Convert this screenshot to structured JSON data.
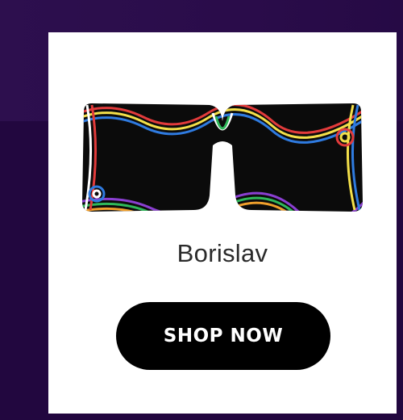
{
  "product": {
    "name": "Borislav",
    "image_alt": "colorful-swirl-square-eyeglasses"
  },
  "cta": {
    "label": "SHOP NOW"
  },
  "colors": {
    "background": "#240a44",
    "card": "#ffffff",
    "button": "#000000",
    "button_text": "#ffffff",
    "frame_base": "#0b0b0b",
    "swirl_colors": [
      "#e23b3b",
      "#f0a02c",
      "#f4e04a",
      "#2fb85a",
      "#2f7be0",
      "#8a3fd1",
      "#ffffff"
    ]
  }
}
